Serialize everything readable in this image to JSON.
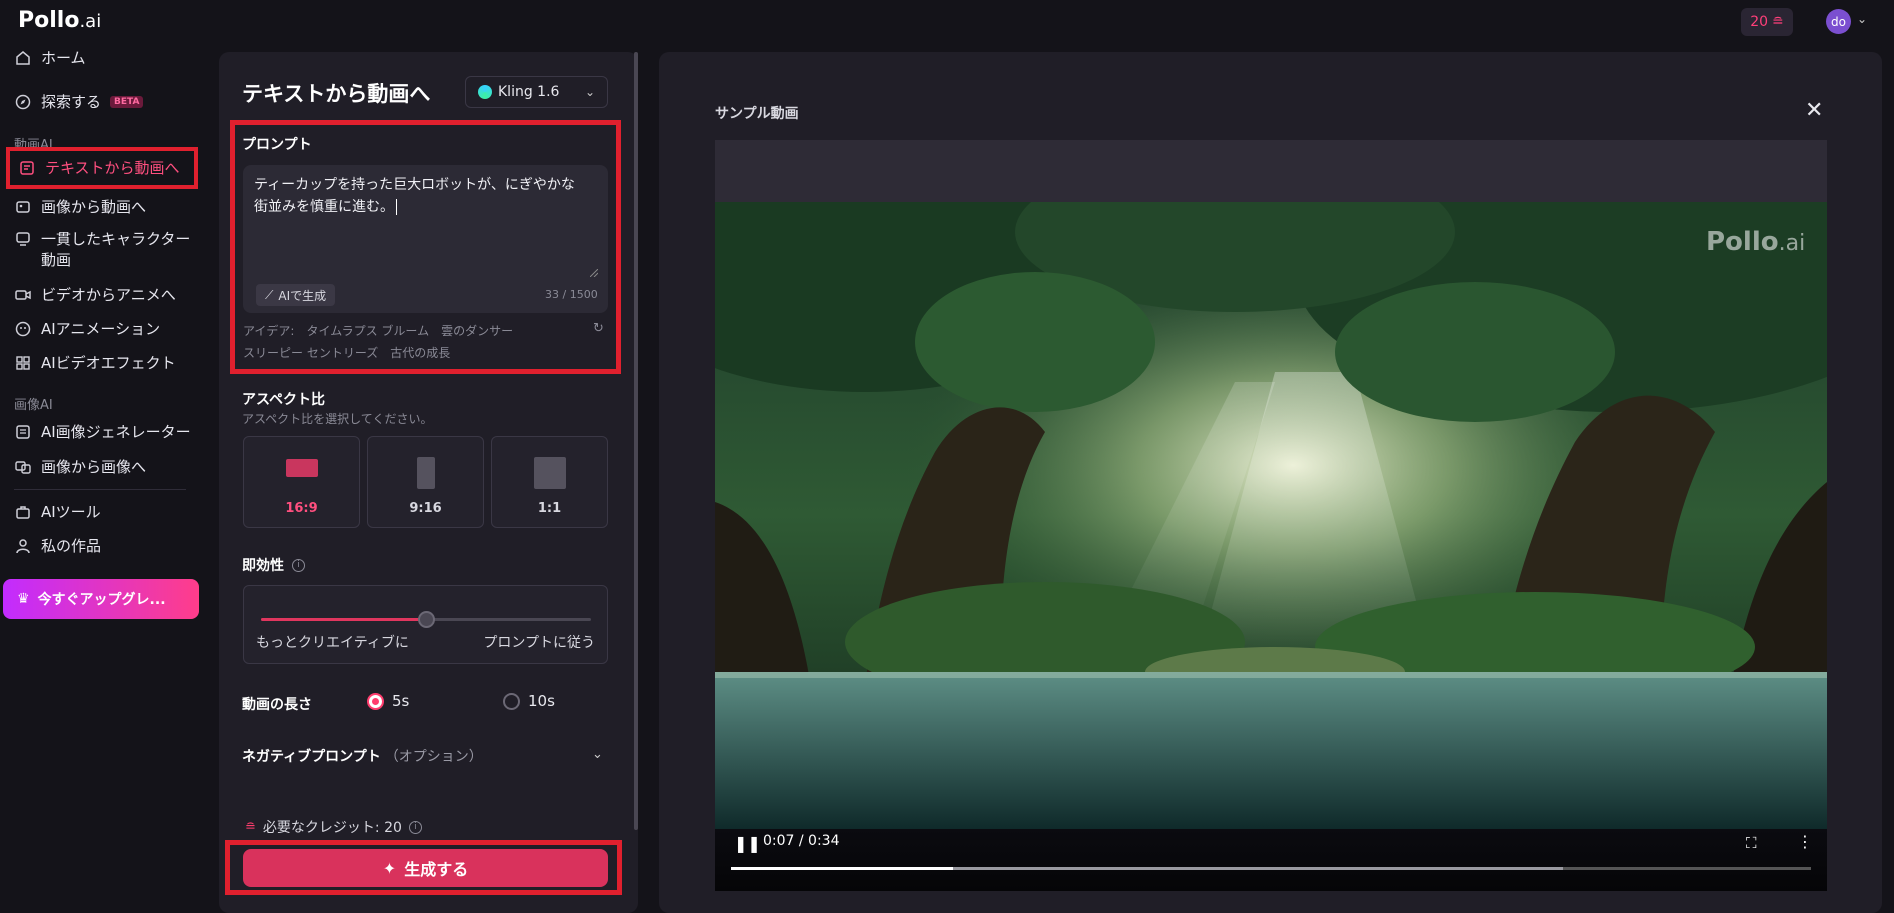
{
  "header": {
    "logo_main": "Pollo",
    "logo_suffix": ".ai",
    "credits": "20",
    "credits_icon": "coin-stack-icon",
    "avatar_initials": "do"
  },
  "sidebar": {
    "items": [
      {
        "label": "ホーム",
        "icon": "home-icon"
      },
      {
        "label": "探索する",
        "icon": "compass-icon",
        "badge": "BETA"
      },
      {
        "label": "テキストから動画へ",
        "icon": "text-video-icon"
      },
      {
        "label": "画像から動画へ",
        "icon": "image-video-icon"
      },
      {
        "label": "一貫したキャラクター",
        "label2": "動画",
        "icon": "character-video-icon"
      },
      {
        "label": "ビデオからアニメへ",
        "icon": "video-anime-icon"
      },
      {
        "label": "AIアニメーション",
        "icon": "animation-icon"
      },
      {
        "label": "AIビデオエフェクト",
        "icon": "effects-icon"
      },
      {
        "label": "AI画像ジェネレーター",
        "icon": "image-gen-icon"
      },
      {
        "label": "画像から画像へ",
        "icon": "image-image-icon"
      },
      {
        "label": "AIツール",
        "icon": "toolbox-icon"
      },
      {
        "label": "私の作品",
        "icon": "user-icon"
      }
    ],
    "section_video": "動画AI",
    "section_image": "画像AI",
    "upgrade_label": "今すぐアップグレ..."
  },
  "panel": {
    "title": "テキストから動画へ",
    "model": "Kling 1.6",
    "prompt_label": "プロンプト",
    "prompt_line1": "ティーカップを持った巨大ロボットが、にぎやかな",
    "prompt_line2": "街並みを慎重に進む。",
    "ai_generate": "AIで生成",
    "char_count": "33 / 1500",
    "ideas_label": "アイデア:",
    "ideas": [
      "タイムラプス ブルーム",
      "雲のダンサー",
      "スリーピー セントリーズ",
      "古代の成長"
    ],
    "aspect_title": "アスペクト比",
    "aspect_sub": "アスペクト比を選択してください。",
    "aspects": [
      "16:9",
      "9:16",
      "1:1"
    ],
    "aspect_selected": "16:9",
    "immediacy_title": "即効性",
    "slider_left": "もっとクリエイティブに",
    "slider_right": "プロンプトに従う",
    "slider_value_fraction": 0.5,
    "duration_title": "動画の長さ",
    "duration_options": [
      "5s",
      "10s"
    ],
    "duration_selected": "5s",
    "negative_title": "ネガティブプロンプト",
    "negative_optional": "（オプション）",
    "required_credits": "必要なクレジット: 20",
    "generate_label": "生成する"
  },
  "preview": {
    "title": "サンプル動画",
    "watermark_main": "Pollo",
    "watermark_suffix": ".ai",
    "time": "0:07 / 0:34",
    "played_fraction": 0.206,
    "buffered_fraction": 0.77
  },
  "colors": {
    "accent": "#ff3d6e",
    "highlight_border": "#e0202e",
    "background": "#141319",
    "panel": "#201e27"
  }
}
